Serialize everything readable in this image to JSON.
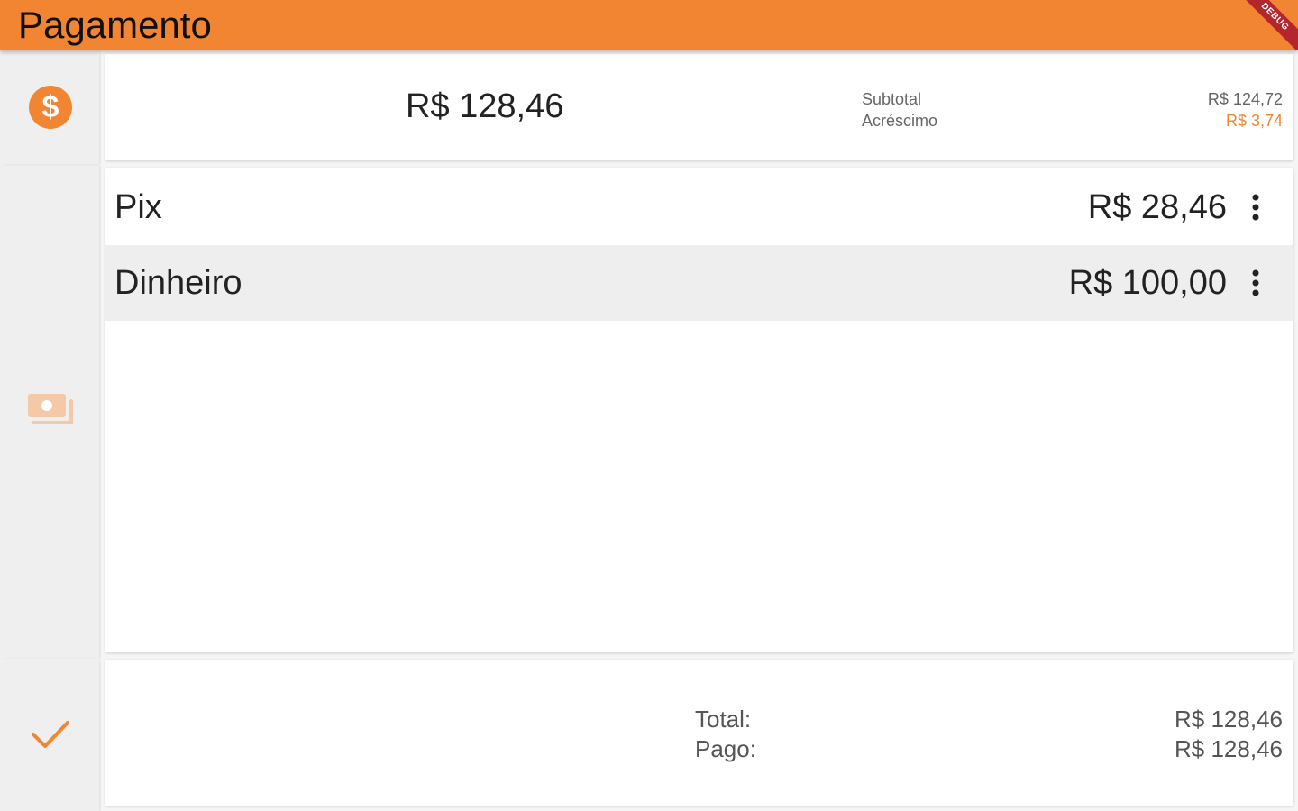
{
  "appbar": {
    "title": "Pagamento",
    "debug_banner": "DEBUG"
  },
  "sidebar": {
    "top_icon": "dollar-circle-icon",
    "middle_icon": "cash-payment-icon",
    "bottom_icon": "check-icon"
  },
  "summary": {
    "total": "R$ 128,46",
    "subtotal_label": "Subtotal",
    "surcharge_label": "Acréscimo",
    "subtotal_value": "R$ 124,72",
    "surcharge_value": "R$ 3,74"
  },
  "payments": [
    {
      "method": "Pix",
      "amount": "R$ 28,46",
      "menu_icon": "more-vertical-icon",
      "selected": false
    },
    {
      "method": "Dinheiro",
      "amount": "R$ 100,00",
      "menu_icon": "more-vertical-icon",
      "selected": true
    }
  ],
  "totals": {
    "total_label": "Total:",
    "paid_label": "Pago:",
    "total_value": "R$ 128,46",
    "paid_value": "R$ 128,46"
  },
  "colors": {
    "accent": "#f28532",
    "debug_banner": "#b3262e",
    "selected_row": "#eeeeee"
  }
}
